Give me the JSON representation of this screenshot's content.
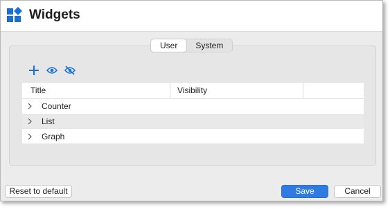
{
  "window": {
    "title": "Widgets"
  },
  "tabs": [
    {
      "label": "User",
      "active": true
    },
    {
      "label": "System",
      "active": false
    }
  ],
  "toolbar": {
    "icons": [
      "plus-icon",
      "eye-icon",
      "eye-slash-icon"
    ]
  },
  "table": {
    "columns": [
      "Title",
      "Visibility"
    ],
    "rows": [
      {
        "title": "Counter",
        "visibility": ""
      },
      {
        "title": "List",
        "visibility": ""
      },
      {
        "title": "Graph",
        "visibility": ""
      }
    ]
  },
  "footer": {
    "reset_label": "Reset to default",
    "save_label": "Save",
    "cancel_label": "Cancel"
  },
  "colors": {
    "accent": "#2f7be3",
    "icon_blue": "#1a6fd6"
  }
}
